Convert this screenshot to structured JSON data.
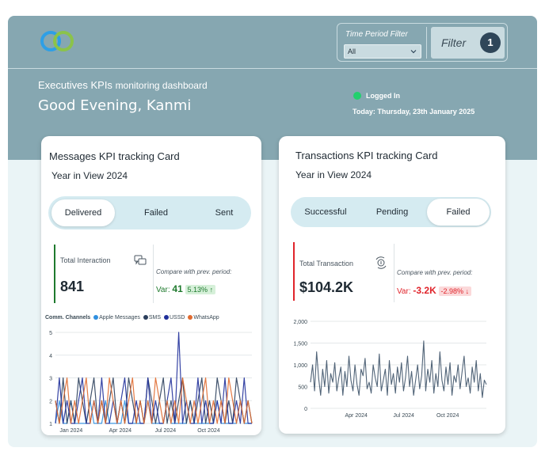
{
  "header": {
    "subtitle_main": "Executives KPIs",
    "subtitle_small": "monitoring dashboard",
    "greeting": "Good Evening, Kanmi",
    "status": "Logged In",
    "date": "Today: Thursday, 23th January 2025",
    "time_period_label": "Time Period Filter",
    "time_period_value": "All",
    "filter_label": "Filter",
    "filter_count": "1"
  },
  "messages_card": {
    "title": "Messages KPI tracking Card",
    "year": "Year in View 2024",
    "tabs": [
      {
        "label": "Delivered",
        "active": true
      },
      {
        "label": "Failed",
        "active": false
      },
      {
        "label": "Sent",
        "active": false
      }
    ],
    "kpi_label": "Total Interaction",
    "kpi_value": "841",
    "compare_label": "Compare with prev. period:",
    "var_prefix": "Var:",
    "var_value": "41",
    "var_pct": "5.13%",
    "var_arrow": "↑",
    "accent": "#1f7a2e",
    "icon": "chat-bubbles-icon"
  },
  "transactions_card": {
    "title": "Transactions KPI tracking Card",
    "year": "Year in View 2024",
    "tabs": [
      {
        "label": "Successful",
        "active": false
      },
      {
        "label": "Pending",
        "active": false
      },
      {
        "label": "Failed",
        "active": true
      }
    ],
    "kpi_label": "Total Transaction",
    "kpi_value": "$104.2K",
    "compare_label": "Compare with prev. period:",
    "var_prefix": "Var:",
    "var_value": "-3.2K",
    "var_pct": "-2.98%",
    "var_arrow": "↓",
    "accent": "#e0242b",
    "icon": "money-exchange-icon"
  },
  "chart_data": [
    {
      "type": "line",
      "title": "",
      "legend_title": "Comm. Channels",
      "legend_placement": "top-left",
      "series": [
        {
          "name": "Apple Messages",
          "color": "#2f8fe0",
          "values": [
            1,
            2,
            1,
            1,
            2,
            1,
            1,
            1,
            1,
            2,
            1,
            1,
            1,
            2,
            1,
            1,
            1,
            1,
            2,
            1,
            1,
            1,
            1,
            1,
            2,
            1,
            1,
            1,
            1,
            2,
            1,
            1,
            1,
            1,
            1,
            2,
            1,
            1,
            1,
            1,
            1,
            1,
            2,
            1,
            1,
            1,
            1,
            1,
            2,
            1,
            1,
            1
          ]
        },
        {
          "name": "SMS",
          "color": "#2b3f5c",
          "values": [
            2,
            1,
            3,
            1,
            2,
            1,
            3,
            2,
            1,
            2,
            3,
            1,
            2,
            1,
            2,
            3,
            1,
            2,
            1,
            3,
            2,
            1,
            2,
            1,
            3,
            2,
            1,
            2,
            3,
            1,
            2,
            1,
            2,
            3,
            1,
            2,
            1,
            2,
            3,
            1,
            2,
            1,
            3,
            2,
            1,
            2,
            1,
            3,
            2,
            1,
            2,
            1
          ]
        },
        {
          "name": "USSD",
          "color": "#1f2f9a",
          "values": [
            1,
            3,
            1,
            2,
            1,
            1,
            2,
            3,
            1,
            1,
            2,
            1,
            3,
            1,
            1,
            2,
            1,
            2,
            3,
            1,
            1,
            2,
            1,
            1,
            3,
            1,
            2,
            1,
            1,
            2,
            3,
            1,
            5,
            1,
            2,
            1,
            1,
            3,
            1,
            2,
            1,
            1,
            2,
            1,
            3,
            1,
            1,
            2,
            1,
            3,
            1,
            1
          ]
        },
        {
          "name": "WhatsApp",
          "color": "#e06a2f",
          "values": [
            2,
            1,
            2,
            3,
            1,
            2,
            1,
            2,
            3,
            1,
            2,
            1,
            2,
            1,
            3,
            2,
            1,
            2,
            1,
            2,
            3,
            1,
            2,
            1,
            2,
            1,
            3,
            2,
            1,
            2,
            1,
            2,
            1,
            3,
            2,
            1,
            2,
            1,
            2,
            3,
            1,
            2,
            1,
            2,
            1,
            3,
            2,
            1,
            2,
            1,
            2,
            1
          ]
        }
      ],
      "x_ticks": [
        "Jan 2024",
        "Apr 2024",
        "Jul 2024",
        "Oct 2024"
      ],
      "y_ticks": [
        "1",
        "2",
        "3",
        "4",
        "5"
      ],
      "ylim": [
        1,
        5
      ],
      "grid": true
    },
    {
      "type": "line",
      "title": "",
      "series": [
        {
          "name": "",
          "color": "#3e5369",
          "values": [
            600,
            1000,
            400,
            1300,
            700,
            300,
            900,
            500,
            1100,
            350,
            800,
            600,
            1050,
            400,
            700,
            950,
            300,
            850,
            500,
            1200,
            650,
            400,
            1000,
            550,
            300,
            900,
            750,
            1150,
            450,
            600,
            350,
            1000,
            700,
            500,
            1250,
            400,
            650,
            900,
            300,
            1100,
            550,
            800,
            350,
            950,
            600,
            1050,
            400,
            700,
            1200,
            500,
            850,
            300,
            650,
            1000,
            450,
            750,
            1550,
            400,
            900,
            600,
            1100,
            350,
            800,
            500,
            1300,
            650,
            400,
            950,
            550,
            1050,
            300,
            750,
            600,
            1000,
            450,
            850,
            1200,
            500,
            700,
            350,
            950,
            600,
            1100,
            400,
            800,
            250,
            650,
            550
          ]
        }
      ],
      "x_ticks": [
        "Apr 2024",
        "Jul 2024",
        "Oct 2024"
      ],
      "y_ticks": [
        "0",
        "500",
        "1,000",
        "1,500",
        "2,000"
      ],
      "ylim": [
        0,
        2000
      ],
      "grid": true
    }
  ]
}
